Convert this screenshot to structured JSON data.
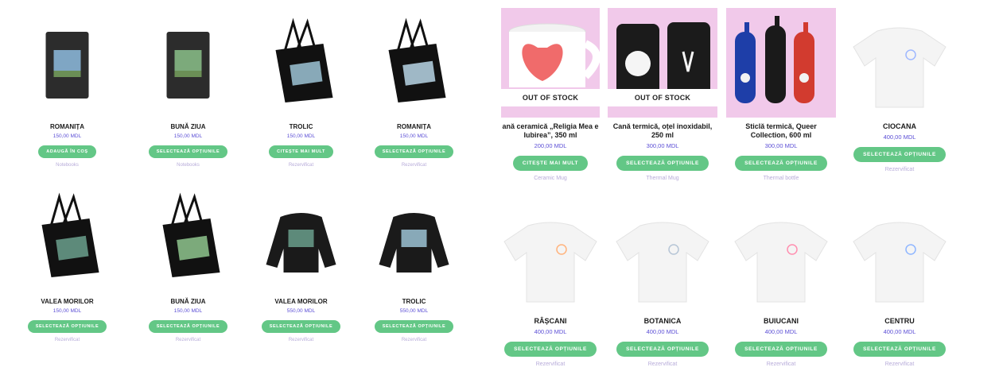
{
  "left_products": [
    {
      "name": "ROMANIȚA",
      "price": "150,00 MDL",
      "button": "ADAUGĂ ÎN COȘ",
      "category": "Notebooks",
      "kind": "notebook",
      "colors": {
        "body": "#2c2c2c",
        "art": "#7fa6c4"
      }
    },
    {
      "name": "BUNĂ ZIUA",
      "price": "150,00 MDL",
      "button": "SELECTEAZĂ OPȚIUNILE",
      "category": "Notebooks",
      "kind": "notebook",
      "colors": {
        "body": "#2c2c2c",
        "art": "#7caa7b"
      }
    },
    {
      "name": "TROLIC",
      "price": "150,00 MDL",
      "button": "CITEȘTE MAI MULT",
      "category": "Rezervificat",
      "kind": "tote",
      "colors": {
        "body": "#111",
        "art": "#88a9b8"
      }
    },
    {
      "name": "ROMANIȚA",
      "price": "150,00 MDL",
      "button": "SELECTEAZĂ OPȚIUNILE",
      "category": "Rezervificat",
      "kind": "tote",
      "colors": {
        "body": "#111",
        "art": "#9fb8c6"
      }
    },
    {
      "name": "VALEA MORILOR",
      "price": "150,00 MDL",
      "button": "SELECTEAZĂ OPȚIUNILE",
      "category": "Rezervificat",
      "kind": "tote",
      "colors": {
        "body": "#111",
        "art": "#5d8a7a"
      }
    },
    {
      "name": "BUNĂ ZIUA",
      "price": "150,00 MDL",
      "button": "SELECTEAZĂ OPȚIUNILE",
      "category": "Rezervificat",
      "kind": "tote",
      "colors": {
        "body": "#111",
        "art": "#7caa7b"
      }
    },
    {
      "name": "VALEA MORILOR",
      "price": "550,00 MDL",
      "button": "SELECTEAZĂ OPȚIUNILE",
      "category": "Rezervificat",
      "kind": "sweater",
      "colors": {
        "body": "#1a1a1a",
        "art": "#5d8a7a"
      }
    },
    {
      "name": "TROLIC",
      "price": "550,00 MDL",
      "button": "SELECTEAZĂ OPȚIUNILE",
      "category": "Rezervificat",
      "kind": "sweater",
      "colors": {
        "body": "#1a1a1a",
        "art": "#88a9b8"
      }
    }
  ],
  "right_products": [
    {
      "name": "ană ceramică „Religia Mea e Iubirea”, 350 ml",
      "price": "200,00 MDL",
      "button": "CITEȘTE MAI MULT",
      "category": "Ceramic Mug",
      "badge": "OUT OF STOCK",
      "kind": "mug",
      "colors": {
        "bg": "#f1c9ea"
      }
    },
    {
      "name": "Cană termică, oțel inoxidabil, 250 ml",
      "price": "300,00 MDL",
      "button": "SELECTEAZĂ OPȚIUNILE",
      "category": "Thermal Mug",
      "badge": "OUT OF STOCK",
      "kind": "thermos",
      "colors": {
        "bg": "#f1c9ea"
      }
    },
    {
      "name": "Sticlă termică, Queer Collection, 600 ml",
      "price": "300,00 MDL",
      "button": "SELECTEAZĂ OPȚIUNILE",
      "category": "Thermal bottle",
      "badge": "",
      "kind": "bottles",
      "colors": {
        "bg": "#f1c9ea"
      }
    },
    {
      "name": "CIOCANA",
      "price": "400,00 MDL",
      "button": "SELECTEAZĂ OPȚIUNILE",
      "category": "Rezervificat",
      "badge": "",
      "kind": "tshirt",
      "colors": {
        "bg": "#ffffff",
        "accent": "#9fb8ff"
      }
    },
    {
      "name": "RÂȘCANI",
      "price": "400,00 MDL",
      "button": "SELECTEAZĂ OPȚIUNILE",
      "category": "Rezervificat",
      "badge": "",
      "kind": "tshirt",
      "colors": {
        "bg": "#ffffff",
        "accent": "#ffb37d"
      }
    },
    {
      "name": "BOTANICA",
      "price": "400,00 MDL",
      "button": "SELECTEAZĂ OPȚIUNILE",
      "category": "Rezervificat",
      "badge": "",
      "kind": "tshirt",
      "colors": {
        "bg": "#ffffff",
        "accent": "#b6c5d6"
      }
    },
    {
      "name": "BUIUCANI",
      "price": "400,00 MDL",
      "button": "SELECTEAZĂ OPȚIUNILE",
      "category": "Rezervificat",
      "badge": "",
      "kind": "tshirt",
      "colors": {
        "bg": "#ffffff",
        "accent": "#ff8fb0"
      }
    },
    {
      "name": "CENTRU",
      "price": "400,00 MDL",
      "button": "SELECTEAZĂ OPȚIUNILE",
      "category": "Rezervificat",
      "badge": "",
      "kind": "tshirt",
      "colors": {
        "bg": "#ffffff",
        "accent": "#8fb6ff"
      }
    }
  ]
}
